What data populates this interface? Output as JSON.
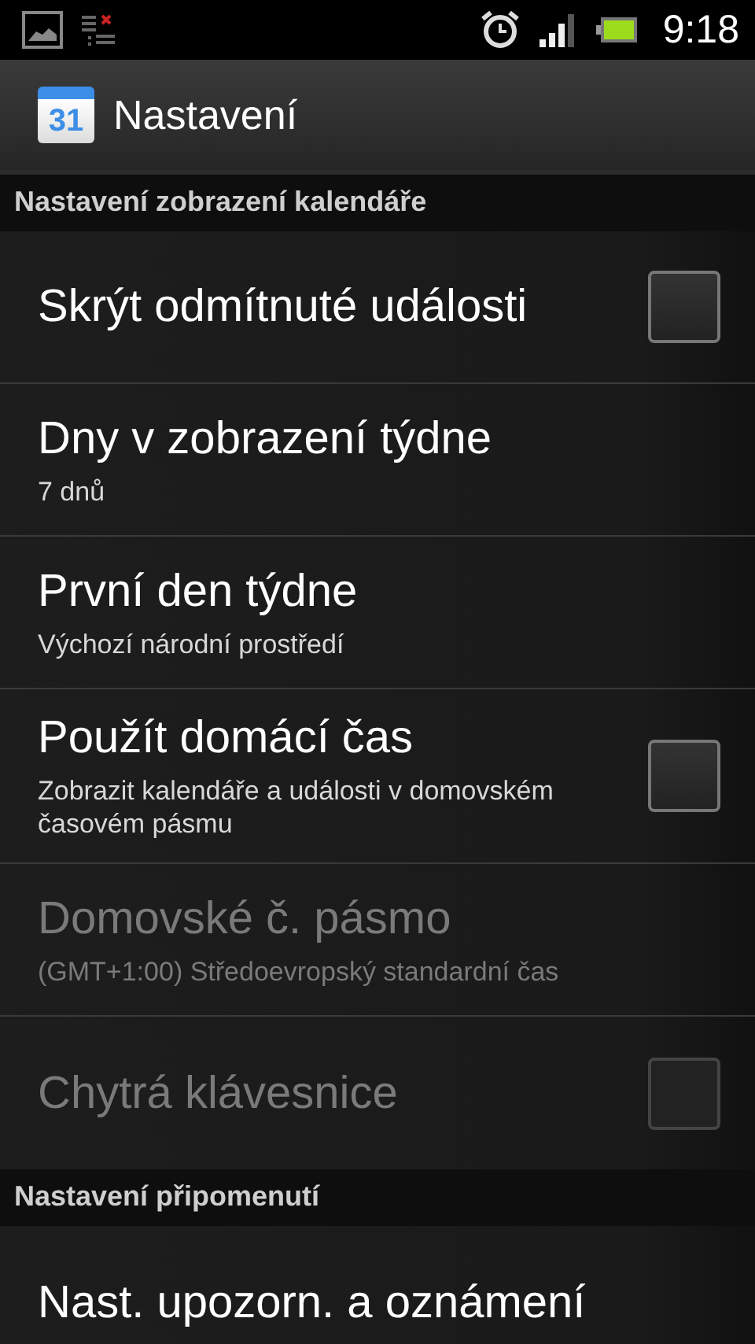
{
  "status_bar": {
    "time": "9:18"
  },
  "action_bar": {
    "icon_label": "31",
    "title": "Nastavení"
  },
  "items": [
    {
      "kind": "header",
      "title": "Nastavení zobrazení kalendáře"
    },
    {
      "kind": "checkbox",
      "title": "Skrýt odmítnuté události",
      "checked": false,
      "disabled": false
    },
    {
      "kind": "plain",
      "title": "Dny v zobrazení týdne",
      "summary": "7 dnů",
      "disabled": false
    },
    {
      "kind": "plain",
      "title": "První den týdne",
      "summary": "Výchozí národní prostředí",
      "disabled": false
    },
    {
      "kind": "checkbox",
      "title": "Použít domácí čas",
      "summary": "Zobrazit kalendáře a události v domovském časovém pásmu",
      "checked": false,
      "disabled": false
    },
    {
      "kind": "plain",
      "title": "Domovské č. pásmo",
      "summary": "(GMT+1:00) Středoevropský standardní čas",
      "disabled": true
    },
    {
      "kind": "checkbox",
      "title": "Chytrá klávesnice",
      "checked": false,
      "disabled": true
    },
    {
      "kind": "header",
      "title": "Nastavení připomenutí"
    },
    {
      "kind": "plain",
      "title": "Nast. upozorn. a oznámení",
      "disabled": false
    }
  ]
}
